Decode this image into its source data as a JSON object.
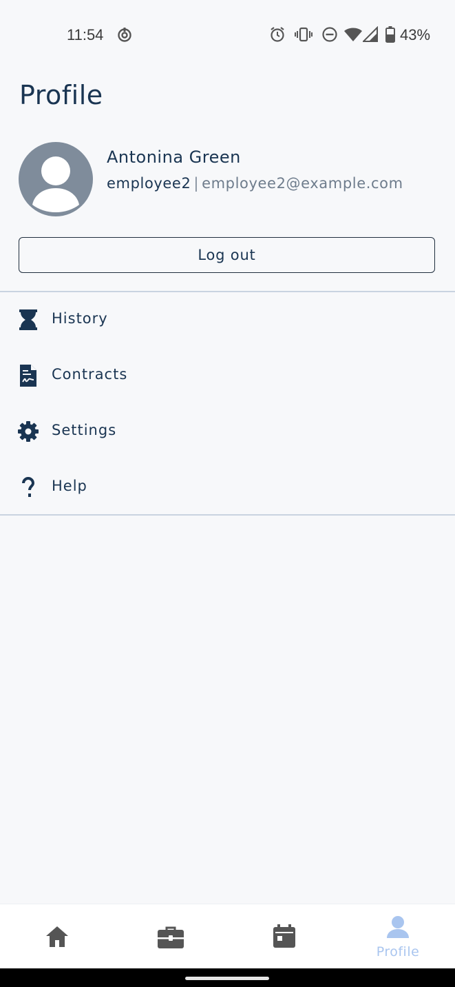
{
  "status_bar": {
    "time": "11:54",
    "battery_percent": "43%",
    "icons": [
      "sync-icon",
      "alarm-icon",
      "vibrate-icon",
      "do-not-disturb-icon",
      "wifi-icon",
      "signal-icon",
      "battery-icon"
    ]
  },
  "page": {
    "title": "Profile"
  },
  "user": {
    "name": "Antonina Green",
    "username": "employee2",
    "separator": "|",
    "email": "employee2@example.com"
  },
  "actions": {
    "logout_label": "Log out"
  },
  "menu": {
    "items": [
      {
        "label": "History",
        "icon": "hourglass-icon"
      },
      {
        "label": "Contracts",
        "icon": "contract-document-icon"
      },
      {
        "label": "Settings",
        "icon": "gear-icon"
      },
      {
        "label": "Help",
        "icon": "question-mark-icon"
      }
    ]
  },
  "bottom_nav": {
    "items": [
      {
        "icon": "home-icon",
        "label": ""
      },
      {
        "icon": "briefcase-icon",
        "label": ""
      },
      {
        "icon": "calendar-icon",
        "label": ""
      },
      {
        "icon": "profile-icon",
        "label": "Profile",
        "active": true
      }
    ]
  },
  "colors": {
    "background": "#f7f8fa",
    "primary_text": "#1a3552",
    "secondary_text": "#6e7c8c",
    "avatar": "#7f8c9b",
    "active_nav": "#a9c5ef",
    "inactive_nav": "#555555"
  }
}
